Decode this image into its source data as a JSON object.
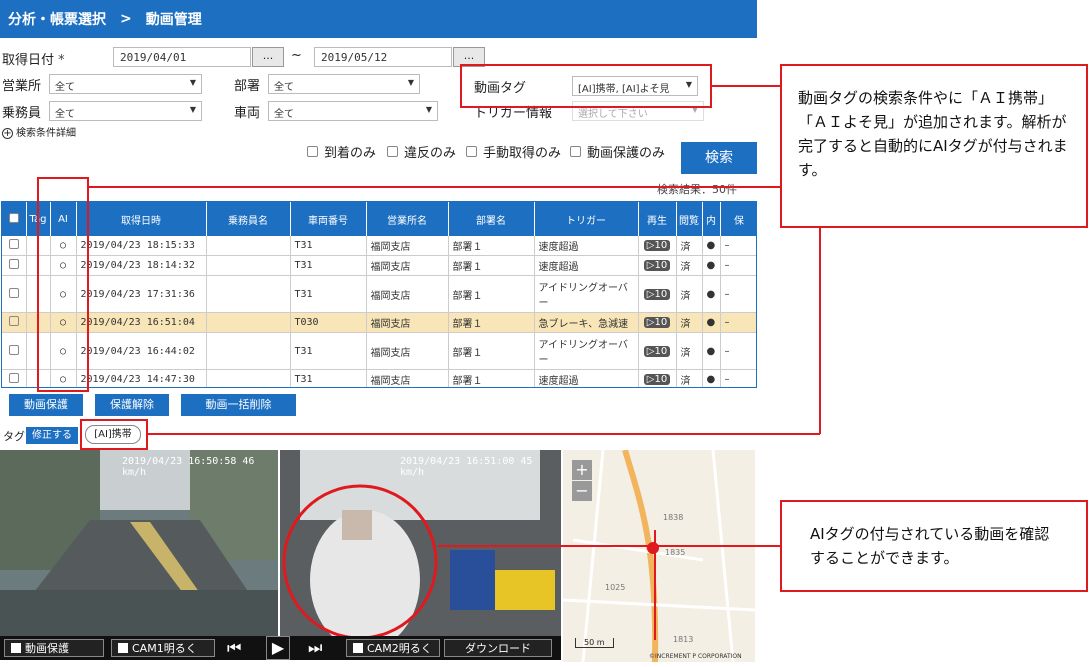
{
  "header": {
    "breadcrumb_1": "分析・帳票選択",
    "separator": ">",
    "title": "動画管理"
  },
  "form": {
    "date_label": "取得日付",
    "required_mark": "*",
    "date_from": "2019/04/01",
    "date_tilde": "~",
    "date_to": "2019/05/12",
    "dots": "...",
    "office_label": "営業所",
    "office_value": "全て",
    "dept_label": "部署",
    "dept_value": "全て",
    "crew_label": "乗務員",
    "crew_value": "全て",
    "vehicle_label": "車両",
    "vehicle_value": "全て",
    "tag_label": "動画タグ",
    "tag_value": "[AI]携帯, [AI]よそ見",
    "trigger_label": "トリガー情報",
    "trigger_placeholder": "選択して下さい",
    "detail_link": "検索条件詳細",
    "check_arrival": "到着のみ",
    "check_violation": "違反のみ",
    "check_manual": "手動取得のみ",
    "check_protected": "動画保護のみ",
    "search_button": "検索",
    "result_count": "検索結果：50件"
  },
  "table": {
    "headers": [
      "",
      "Tag",
      "AI",
      "取得日時",
      "乗務員名",
      "車両番号",
      "営業所名",
      "部署名",
      "トリガー",
      "再生",
      "閲覧",
      "内",
      "保"
    ],
    "rows": [
      {
        "ai": "○",
        "datetime": "2019/04/23 18:15:33",
        "driver": "",
        "vehicle": "T31",
        "office": "福岡支店",
        "dept": "部署１",
        "trigger": "速度超過",
        "play": "▷10",
        "viewed": "済",
        "inner": "●",
        "prot": "–",
        "highlight": false
      },
      {
        "ai": "○",
        "datetime": "2019/04/23 18:14:32",
        "driver": "",
        "vehicle": "T31",
        "office": "福岡支店",
        "dept": "部署１",
        "trigger": "速度超過",
        "play": "▷10",
        "viewed": "済",
        "inner": "●",
        "prot": "–",
        "highlight": false
      },
      {
        "ai": "○",
        "datetime": "2019/04/23 17:31:36",
        "driver": "",
        "vehicle": "T31",
        "office": "福岡支店",
        "dept": "部署１",
        "trigger": "アイドリングオーバー",
        "play": "▷10",
        "viewed": "済",
        "inner": "●",
        "prot": "–",
        "highlight": false
      },
      {
        "ai": "○",
        "datetime": "2019/04/23 16:51:04",
        "driver": "",
        "vehicle": "T030",
        "office": "福岡支店",
        "dept": "部署１",
        "trigger": "急ブレーキ、急減速",
        "play": "▷10",
        "viewed": "済",
        "inner": "●",
        "prot": "–",
        "highlight": true
      },
      {
        "ai": "○",
        "datetime": "2019/04/23 16:44:02",
        "driver": "",
        "vehicle": "T31",
        "office": "福岡支店",
        "dept": "部署１",
        "trigger": "アイドリングオーバー",
        "play": "▷10",
        "viewed": "済",
        "inner": "●",
        "prot": "–",
        "highlight": false
      },
      {
        "ai": "○",
        "datetime": "2019/04/23 14:47:30",
        "driver": "",
        "vehicle": "T31",
        "office": "福岡支店",
        "dept": "部署１",
        "trigger": "速度超過",
        "play": "▷10",
        "viewed": "済",
        "inner": "●",
        "prot": "–",
        "highlight": false
      }
    ]
  },
  "actions": {
    "protect": "動画保護",
    "unprotect": "保護解除",
    "bulk_delete": "動画一括削除"
  },
  "tag_row": {
    "label": "タグ",
    "fix_button": "修正する",
    "chip": "[AI]携帯"
  },
  "video": {
    "cam1_ts": "2019/04/23 16:50:58  46 km/h",
    "cam2_ts": "2019/04/23 16:51:00  45 km/h",
    "map_plus": "+",
    "map_minus": "−",
    "map_scale": "50 m",
    "map_credit": "©INCREMENT P CORPORATION",
    "map_numbers": [
      "1838",
      "1835",
      "1025",
      "1813"
    ]
  },
  "controls": {
    "protect": "動画保護",
    "cam1_bright": "CAM1明るく",
    "prev": "⏮",
    "play": "▶",
    "next": "⏭",
    "cam2_bright": "CAM2明るく",
    "download": "ダウンロード"
  },
  "callouts": {
    "top": "動画タグの検索条件やに「ＡＩ携帯」「ＡＩよそ見」が追加されます。解析が完了すると自動的にAIタグが付与されます。",
    "bottom": "AIタグの付与されている動画を確認することができます。"
  },
  "colors": {
    "primary": "#1d6fc1",
    "highlight": "#f8e6b8",
    "annotation": "#e0191f"
  }
}
